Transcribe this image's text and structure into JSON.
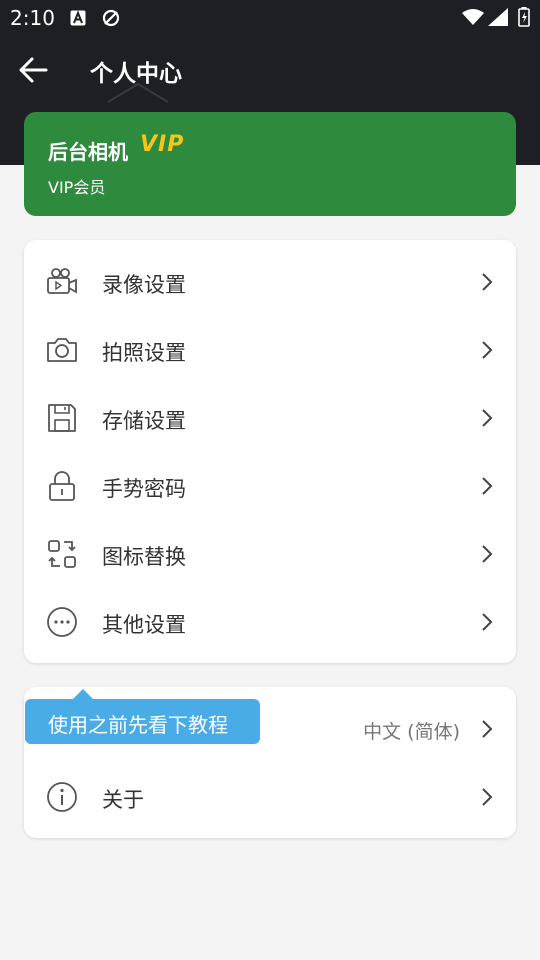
{
  "status_bar": {
    "time": "2:10"
  },
  "header": {
    "title": "个人中心"
  },
  "vip_card": {
    "title": "后台相机",
    "badge": "VIP",
    "subtitle": "VIP会员"
  },
  "settings": {
    "items": [
      {
        "label": "录像设置",
        "icon": "video-camera-icon"
      },
      {
        "label": "拍照设置",
        "icon": "camera-icon"
      },
      {
        "label": "存储设置",
        "icon": "save-icon"
      },
      {
        "label": "手势密码",
        "icon": "lock-icon"
      },
      {
        "label": "图标替换",
        "icon": "swap-icon"
      },
      {
        "label": "其他设置",
        "icon": "more-icon"
      }
    ]
  },
  "general": {
    "language_value": "中文 (简体)",
    "about_label": "关于"
  },
  "tooltip": {
    "text": "使用之前先看下教程"
  },
  "colors": {
    "header_bg": "#1e1f24",
    "vip_green": "#2e8a3c",
    "vip_gold": "#f6c51c",
    "tooltip_blue": "#4aace6"
  }
}
